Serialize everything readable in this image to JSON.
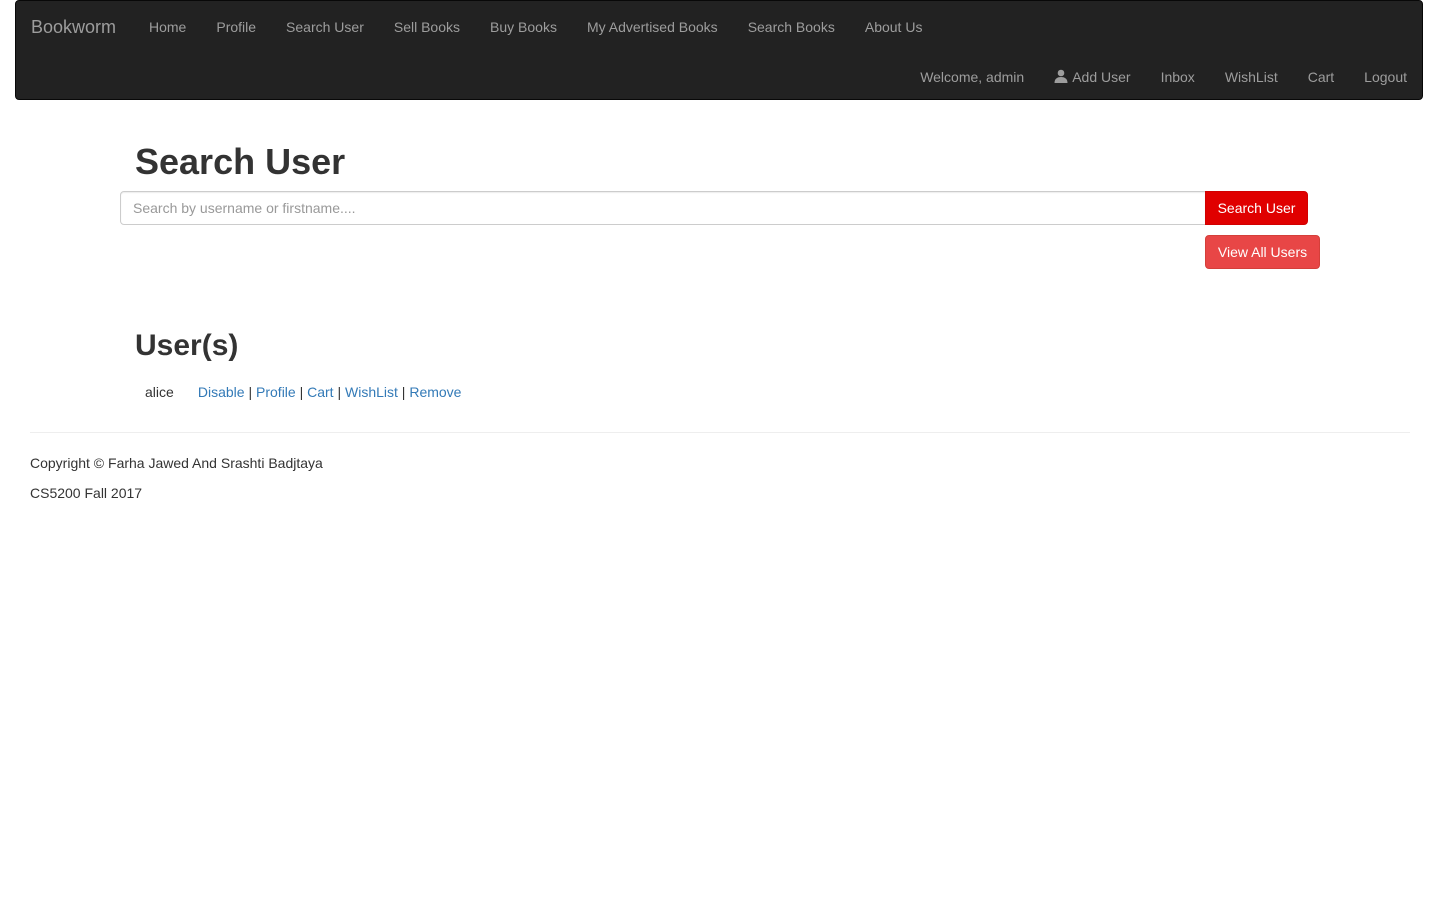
{
  "navbar": {
    "brand": "Bookworm",
    "top_items": [
      {
        "label": "Home"
      },
      {
        "label": "Profile"
      },
      {
        "label": "Search User"
      },
      {
        "label": "Sell Books"
      },
      {
        "label": "Buy Books"
      },
      {
        "label": "My Advertised Books"
      },
      {
        "label": "Search Books"
      },
      {
        "label": "About Us"
      }
    ],
    "right_items": {
      "welcome": "Welcome, admin",
      "add_user": "Add User",
      "add_user_icon": "user-icon",
      "inbox": "Inbox",
      "wishlist": "WishList",
      "cart": "Cart",
      "logout": "Logout"
    },
    "background_color": "#222222",
    "link_color": "#9d9d9d"
  },
  "main": {
    "title": "Search User",
    "search": {
      "placeholder": "Search by username or firstname....",
      "value": "",
      "button_label": "Search User",
      "button_color": "#e00000"
    },
    "view_all_label": "View All Users",
    "view_all_color": "#e84646",
    "users_title": "User(s)",
    "users": [
      {
        "username": "alice",
        "actions": {
          "disable": "Disable",
          "profile": "Profile",
          "cart": "Cart",
          "wishlist": "WishList",
          "remove": "Remove"
        }
      }
    ],
    "separator": "|"
  },
  "footer": {
    "copyright": "Copyright © Farha Jawed And Srashti Badjtaya",
    "course": "CS5200 Fall 2017"
  }
}
